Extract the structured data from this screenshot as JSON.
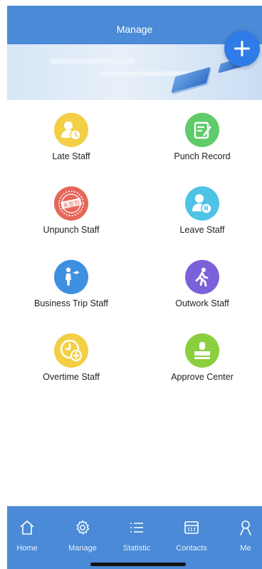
{
  "header": {
    "title": "Manage"
  },
  "fab": {
    "icon": "plus-icon"
  },
  "menu": [
    {
      "label": "Late Staff",
      "icon": "late-staff-icon",
      "color": "#f2cf45"
    },
    {
      "label": "Punch Record",
      "icon": "punch-record-icon",
      "color": "#5fcb6a"
    },
    {
      "label": "Unpunch Staff",
      "icon": "unpunch-staff-icon",
      "color": "#e5675a"
    },
    {
      "label": "Leave Staff",
      "icon": "leave-staff-icon",
      "color": "#4fc3e6"
    },
    {
      "label": "Business Trip Staff",
      "icon": "business-trip-icon",
      "color": "#3d8fe0"
    },
    {
      "label": "Outwork Staff",
      "icon": "outwork-staff-icon",
      "color": "#7b61d9"
    },
    {
      "label": "Overtime Staff",
      "icon": "overtime-staff-icon",
      "color": "#f2cf45"
    },
    {
      "label": "Approve Center",
      "icon": "approve-center-icon",
      "color": "#8ccf3e"
    }
  ],
  "stamp_text": "未签到",
  "tabs": [
    {
      "label": "Home",
      "icon": "home-icon"
    },
    {
      "label": "Manage",
      "icon": "gear-icon"
    },
    {
      "label": "Statistic",
      "icon": "list-icon"
    },
    {
      "label": "Contacts",
      "icon": "contacts-icon"
    },
    {
      "label": "Me",
      "icon": "person-icon"
    }
  ]
}
